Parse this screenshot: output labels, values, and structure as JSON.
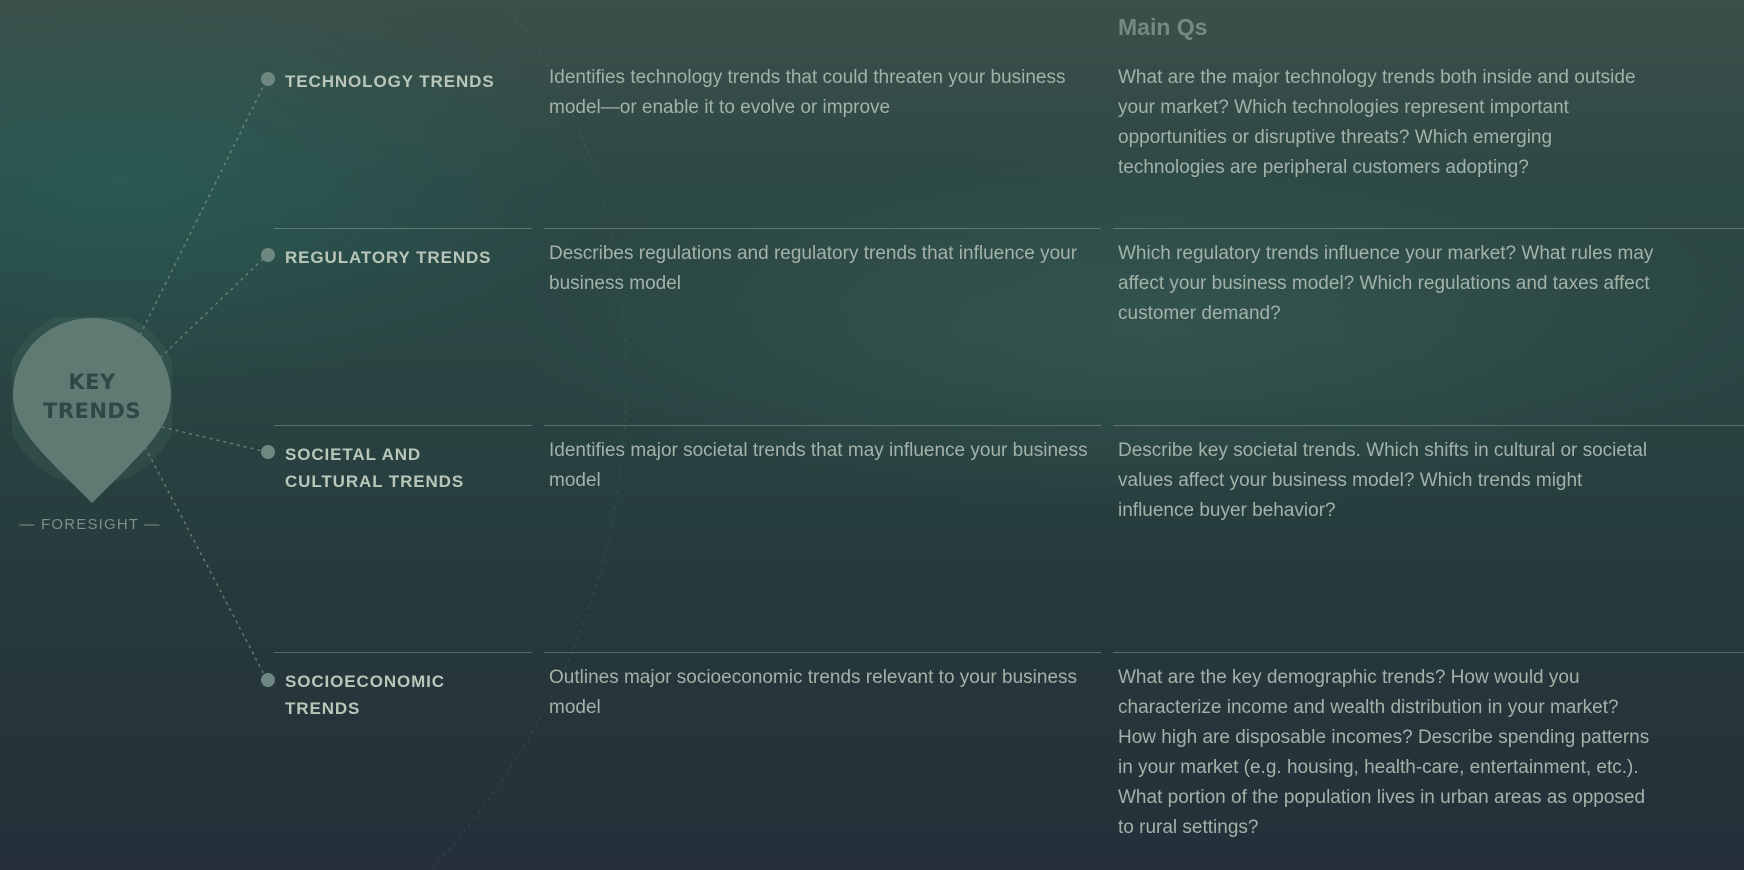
{
  "pin": {
    "line1": "KEY",
    "line2": "TRENDS",
    "caption": "— FORESIGHT —"
  },
  "header": {
    "questions_title": "Main Qs"
  },
  "trends": [
    {
      "label": "TECHNOLOGY TRENDS",
      "description": "Identifies technology trends that could threaten your business model—or enable it to evolve or improve",
      "questions": "What are the major technology trends both inside and outside your market? Which technologies represent important opportunities or disruptive threats? Which emerging technologies are peripheral customers adopting?"
    },
    {
      "label": "REGULATORY TRENDS",
      "description": "Describes regulations and regulatory trends that influence your business model",
      "questions": "Which regulatory trends influence your market? What rules may affect your business model? Which regulations and taxes affect customer demand?"
    },
    {
      "label": "SOCIETAL AND CULTURAL TRENDS",
      "description": "Identifies major societal trends that may influence your business model",
      "questions": "Describe key societal trends. Which shifts in cultural or societal values affect your business model? Which trends might influence buyer behavior?"
    },
    {
      "label": "SOCIOECONOMIC TRENDS",
      "description": "Outlines major socioeconomic trends relevant to your business model",
      "questions": "What are the key demographic trends? How would you characterize income and wealth distribution in your market? How high are disposable incomes? Describe spending patterns in your market (e.g. housing, health-care, entertainment, etc.). What portion of the population lives in urban areas as opposed to rural settings?"
    }
  ],
  "colors": {
    "background_top": "#3d4f4a",
    "background_bottom": "#25303a",
    "pin_fill": "#5f7a73",
    "label_text": "#b9c7ba",
    "body_text": "#a3b2a9",
    "dot": "#6f8781"
  }
}
